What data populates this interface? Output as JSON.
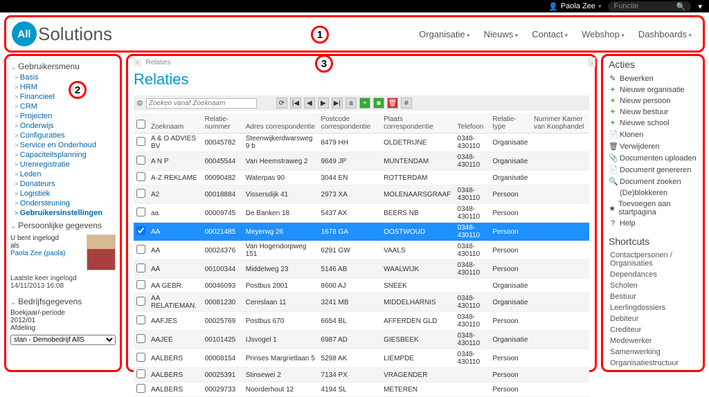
{
  "topbar": {
    "user": "Paola Zee",
    "user_icon": "👤",
    "search_placeholder": "Functie",
    "search_icon": "🔍"
  },
  "logo": {
    "bubble": "All",
    "text": "Solutions"
  },
  "badges": {
    "b1": "1",
    "b2": "2",
    "b3": "3"
  },
  "topnav": [
    "Organisatie",
    "Nieuws",
    "Contact",
    "Webshop",
    "Dashboards"
  ],
  "leftmenu": {
    "head": "Gebruikersmenu",
    "items": [
      "Basis",
      "HRM",
      "Financieel",
      "CRM",
      "Projecten",
      "Onderwijs",
      "Configuraties",
      "Service en Onderhoud",
      "Capaciteitsplanning",
      "Urenregistratie",
      "Leden",
      "Donateurs",
      "Logistiek",
      "Ondersteuning",
      "Gebruikersinstellingen"
    ]
  },
  "personal": {
    "head": "Persoonlijke gegevens",
    "line1": "U bent ingelogd",
    "line2": "als",
    "user": "Paola Zee (paola)",
    "last_label": "Laatste keer ingelogd",
    "last_value": "14/11/2013 16:08"
  },
  "bedrijf": {
    "head": "Bedrijfsgegevens",
    "l1": "Boekjaar/-periode",
    "l2": "2012/01",
    "l3": "Afdeling",
    "select": "stan - Demobedrijf AllS"
  },
  "breadcrumb": "Relaties",
  "page_title": "Relaties",
  "search_ph": "Zoeken vanaf Zoeknaam",
  "tool_icons": {
    "gear": "⚙",
    "refresh": "⟳",
    "first": "|◀",
    "prev": "◀",
    "next": "▶",
    "last": "▶|",
    "find": "a",
    "add": "+",
    "edit": "■",
    "del": "🗑",
    "hash": "#"
  },
  "columns": [
    "",
    "Zoeknaam",
    "Relatie-nummer",
    "Adres correspondentie",
    "Postcode correspondentie",
    "Plaats correspondentie",
    "Telefoon",
    "Relatie-type",
    "Nummer Kamer van Koophandel"
  ],
  "rows": [
    {
      "zoek": "A & O ADVIES BV",
      "num": "00045782",
      "adres": "Steenwijkerdwarsweg 9 b",
      "pc": "8479 HH",
      "plaats": "OLDETRIJNE",
      "tel": "0348-430110",
      "type": "Organisatie",
      "kvk": ""
    },
    {
      "zoek": "A N P",
      "num": "00045544",
      "adres": "Van Heemstraweg 2",
      "pc": "9649 JP",
      "plaats": "MUNTENDAM",
      "tel": "0348-430110",
      "type": "Organisatie",
      "kvk": ""
    },
    {
      "zoek": "A-Z REKLAME",
      "num": "00090482",
      "adres": "Waterpas 90",
      "pc": "3044 EN",
      "plaats": "ROTTERDAM",
      "tel": "",
      "type": "Organisatie",
      "kvk": ""
    },
    {
      "zoek": "A2",
      "num": "00018884",
      "adres": "Vissersdijk 41",
      "pc": "2973 XA",
      "plaats": "MOLENAARSGRAAF",
      "tel": "0348-430110",
      "type": "Persoon",
      "kvk": ""
    },
    {
      "zoek": "aa",
      "num": "00009745",
      "adres": "De Banken 18",
      "pc": "5437 AX",
      "plaats": "BEERS NB",
      "tel": "0348-430110",
      "type": "Persoon",
      "kvk": ""
    },
    {
      "zoek": "AA",
      "num": "00021485",
      "adres": "Meyerwg 26",
      "pc": "1678 GA",
      "plaats": "OOSTWOUD",
      "tel": "0348-430110",
      "type": "Persoon",
      "kvk": "",
      "selected": true
    },
    {
      "zoek": "AA",
      "num": "00024376",
      "adres": "Van Hogendorpweg 151",
      "pc": "6291 GW",
      "plaats": "VAALS",
      "tel": "0348-430110",
      "type": "Persoon",
      "kvk": ""
    },
    {
      "zoek": "AA",
      "num": "00100344",
      "adres": "Middelweg 23",
      "pc": "5146 AB",
      "plaats": "WAALWIJK",
      "tel": "0348-430110",
      "type": "Persoon",
      "kvk": ""
    },
    {
      "zoek": "AA GEBR.",
      "num": "00046093",
      "adres": "Postbus 2001",
      "pc": "8600 AJ",
      "plaats": "SNEEK",
      "tel": "",
      "type": "Organisatie",
      "kvk": ""
    },
    {
      "zoek": "AA RELATIEMAN.",
      "num": "00081230",
      "adres": "Cereslaan 11",
      "pc": "3241 MB",
      "plaats": "MIDDELHARNIS",
      "tel": "0348-430110",
      "type": "Organisatie",
      "kvk": ""
    },
    {
      "zoek": "AAFJES",
      "num": "00025769",
      "adres": "Postbus 670",
      "pc": "6654 BL",
      "plaats": "AFFERDEN GLD",
      "tel": "0348-430110",
      "type": "Persoon",
      "kvk": ""
    },
    {
      "zoek": "AAJEE",
      "num": "00101425",
      "adres": "IJsvogel 1",
      "pc": "6987 AD",
      "plaats": "GIESBEEK",
      "tel": "0348-430110",
      "type": "Organisatie",
      "kvk": ""
    },
    {
      "zoek": "AALBERS",
      "num": "00008154",
      "adres": "Prinses Margrietlaan 5",
      "pc": "5298 AK",
      "plaats": "LIEMPDE",
      "tel": "0348-430110",
      "type": "Persoon",
      "kvk": ""
    },
    {
      "zoek": "AALBERS",
      "num": "00025391",
      "adres": "Stinsewei 2",
      "pc": "7134 PX",
      "plaats": "VRAGENDER",
      "tel": "",
      "type": "Persoon",
      "kvk": ""
    },
    {
      "zoek": "AALBERS",
      "num": "00029733",
      "adres": "Noorderhout 12",
      "pc": "4194 SL",
      "plaats": "METEREN",
      "tel": "",
      "type": "Persoon",
      "kvk": ""
    }
  ],
  "acties": {
    "head": "Acties",
    "items": [
      {
        "ico": "✎",
        "label": "Bewerken"
      },
      {
        "ico": "+",
        "cls": "plus-g",
        "label": "Nieuwe organisatie"
      },
      {
        "ico": "+",
        "cls": "plus-g",
        "label": "Nieuw persoon"
      },
      {
        "ico": "+",
        "cls": "plus-g",
        "label": "Nieuw bestuur"
      },
      {
        "ico": "+",
        "cls": "plus-g",
        "label": "Nieuwe school"
      },
      {
        "ico": "📄",
        "cls": "doc",
        "label": "Klonen"
      },
      {
        "ico": "🗑",
        "label": "Verwijderen"
      },
      {
        "ico": "📎",
        "cls": "doc",
        "label": "Documenten uploaden"
      },
      {
        "ico": "📄",
        "cls": "doc",
        "label": "Document genereren"
      },
      {
        "ico": "🔍",
        "label": "Document zoeken"
      },
      {
        "ico": "",
        "label": "(De)blokkeren"
      },
      {
        "ico": "★",
        "label": "Toevoegen aan startpagina"
      },
      {
        "ico": "?",
        "label": "Help"
      }
    ]
  },
  "shortcuts": {
    "head": "Shortcuts",
    "items": [
      "Contactpersonen / Organisaties",
      "Dependances",
      "Scholen",
      "Bestuur",
      "Leerlingdossiers",
      "Debiteur",
      "Crediteur",
      "Medewerker",
      "Samenwerking",
      "Organisatiestructuur"
    ]
  }
}
